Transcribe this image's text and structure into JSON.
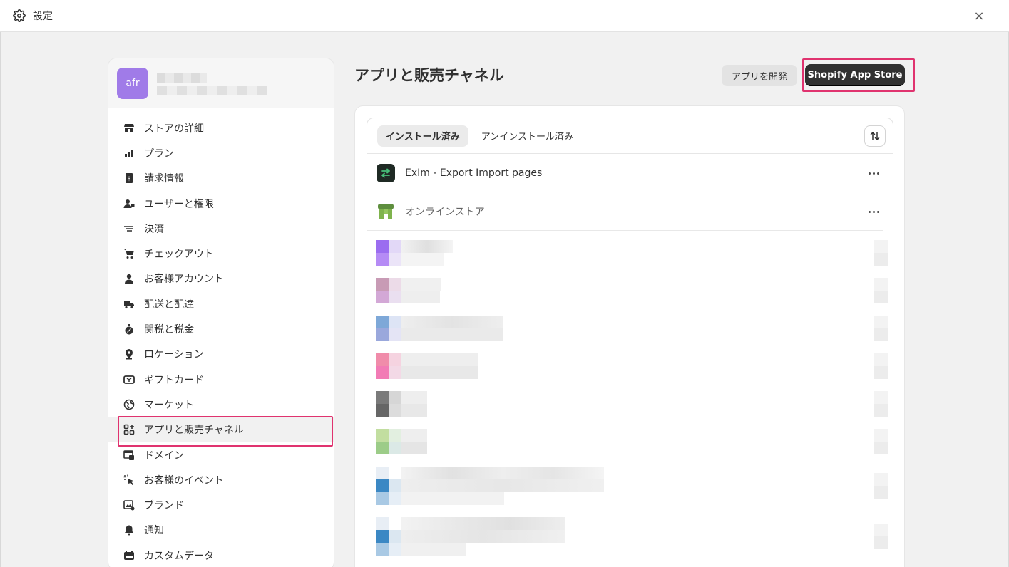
{
  "topbar": {
    "title": "設定",
    "close": "×"
  },
  "store": {
    "avatar": "afr"
  },
  "nav": [
    {
      "label": "ストアの詳細",
      "icon": "store-icon"
    },
    {
      "label": "プラン",
      "icon": "plan-icon"
    },
    {
      "label": "請求情報",
      "icon": "billing-icon"
    },
    {
      "label": "ユーザーと権限",
      "icon": "users-icon"
    },
    {
      "label": "決済",
      "icon": "payments-icon"
    },
    {
      "label": "チェックアウト",
      "icon": "cart-icon"
    },
    {
      "label": "お客様アカウント",
      "icon": "person-icon"
    },
    {
      "label": "配送と配達",
      "icon": "truck-icon"
    },
    {
      "label": "関税と税金",
      "icon": "tax-icon"
    },
    {
      "label": "ロケーション",
      "icon": "location-icon"
    },
    {
      "label": "ギフトカード",
      "icon": "gift-card-icon"
    },
    {
      "label": "マーケット",
      "icon": "globe-icon"
    },
    {
      "label": "アプリと販売チャネル",
      "icon": "apps-icon"
    },
    {
      "label": "ドメイン",
      "icon": "domain-icon"
    },
    {
      "label": "お客様のイベント",
      "icon": "cursor-icon"
    },
    {
      "label": "ブランド",
      "icon": "brand-icon"
    },
    {
      "label": "通知",
      "icon": "bell-icon"
    },
    {
      "label": "カスタムデータ",
      "icon": "data-icon"
    }
  ],
  "main": {
    "title": "アプリと販売チャネル",
    "dev_button": "アプリを開発",
    "store_button": "Shopify App Store",
    "tabs": [
      "インストール済み",
      "アンインストール済み"
    ],
    "apps": [
      {
        "name": "ExIm - Export Import pages"
      },
      {
        "name": "オンラインストア"
      }
    ]
  },
  "colors": {
    "accent": "#e0336f",
    "primary_button": "#303030",
    "avatar": "#a07be8"
  }
}
